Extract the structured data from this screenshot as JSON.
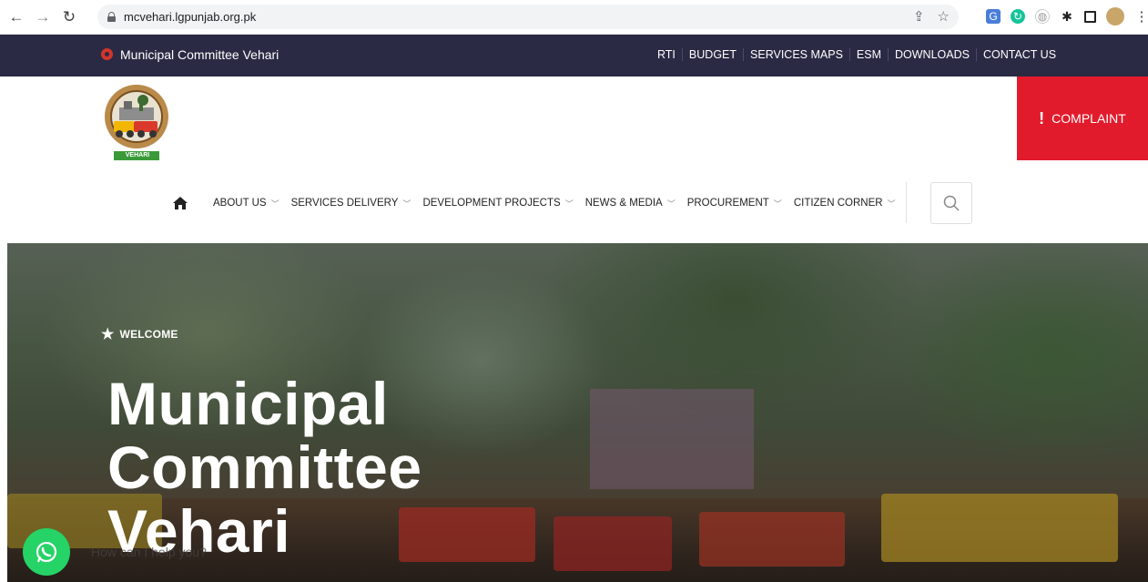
{
  "browser": {
    "url": "mcvehari.lgpunjab.org.pk",
    "back_icon": "back-arrow-icon",
    "forward_icon": "forward-arrow-icon",
    "reload_icon": "reload-icon"
  },
  "topbar": {
    "site_name": "Municipal Committee Vehari",
    "links": [
      "RTI",
      "BUDGET",
      "SERVICES MAPS",
      "ESM",
      "DOWNLOADS",
      "CONTACT US"
    ]
  },
  "header": {
    "logo_text": "VEHARI",
    "complaint_label": "COMPLAINT",
    "complaint_color": "#e21b2c"
  },
  "nav": {
    "items": [
      "ABOUT US",
      "SERVICES DELIVERY",
      "DEVELOPMENT PROJECTS",
      "NEWS & MEDIA",
      "PROCUREMENT",
      "CITIZEN CORNER"
    ]
  },
  "hero": {
    "eyebrow": "WELCOME",
    "title_lines": [
      "Municipal",
      "Committee",
      "Vehari"
    ]
  },
  "whatsapp": {
    "prompt": "How can I help you?",
    "color": "#25d366"
  },
  "colors": {
    "topstrip": "#2a2a44",
    "accent": "#e21b2c"
  }
}
